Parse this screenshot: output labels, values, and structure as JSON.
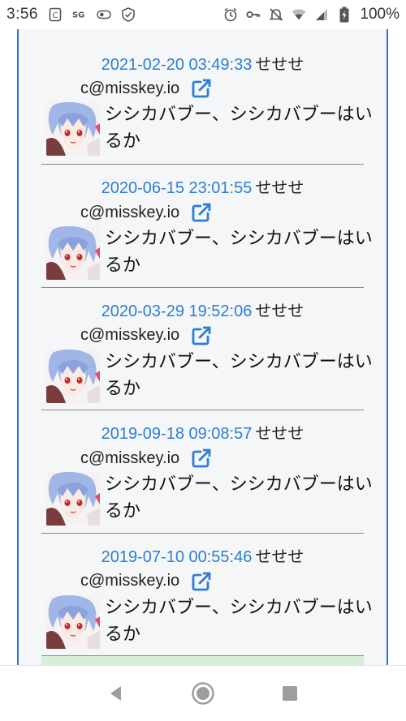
{
  "status_bar": {
    "time": "3:56",
    "battery": "100%"
  },
  "feed": {
    "items": [
      {
        "timestamp": "2021-02-20 03:49:33",
        "username": "せせせ",
        "account": "c@misskey.io",
        "text": "シシカバブー、シシカバブーはいるか"
      },
      {
        "timestamp": "2020-06-15 23:01:55",
        "username": "せせせ",
        "account": "c@misskey.io",
        "text": "シシカバブー、シシカバブーはいるか"
      },
      {
        "timestamp": "2020-03-29 19:52:06",
        "username": "せせせ",
        "account": "c@misskey.io",
        "text": "シシカバブー、シシカバブーはいるか"
      },
      {
        "timestamp": "2019-09-18 09:08:57",
        "username": "せせせ",
        "account": "c@misskey.io",
        "text": "シシカバブー、シシカバブーはいるか"
      },
      {
        "timestamp": "2019-07-10 00:55:46",
        "username": "せせせ",
        "account": "c@misskey.io",
        "text": "シシカバブー、シシカバブーはいるか"
      }
    ]
  },
  "icons": {
    "external_link": "external-link-icon",
    "avatar": "avatar-image"
  },
  "colors": {
    "accent": "#2b7fd4",
    "frame_border": "#2979d8",
    "background": "#f5f6f8",
    "next_item_bg": "#d7eed9"
  }
}
